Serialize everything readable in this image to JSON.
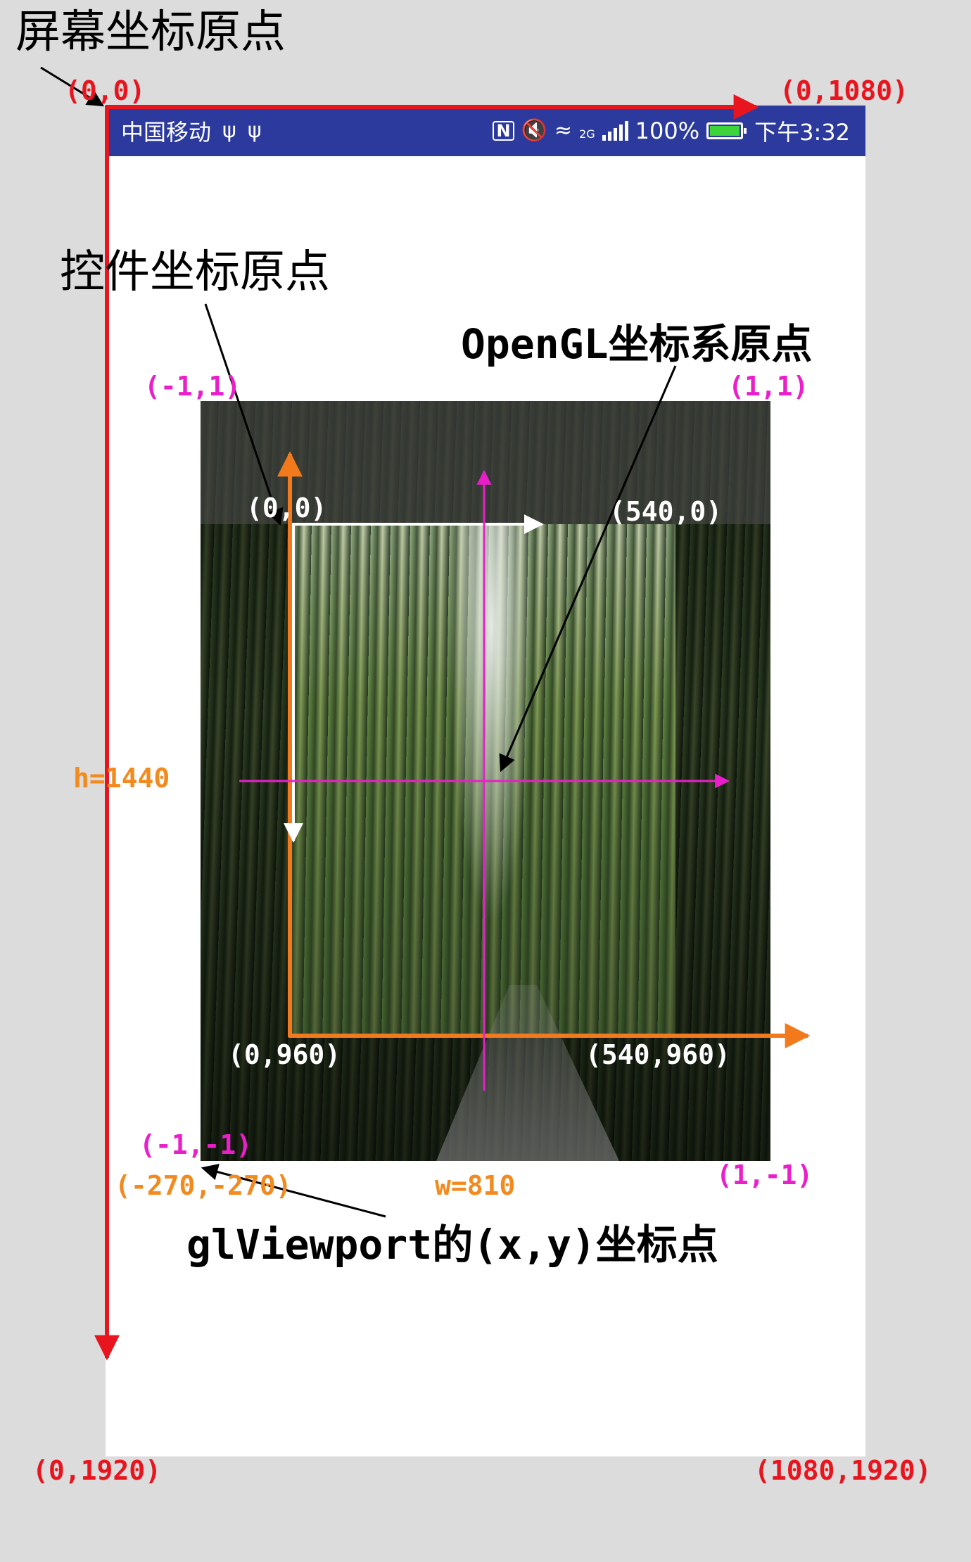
{
  "titles": {
    "screen_origin": "屏幕坐标原点",
    "widget_origin": "控件坐标原点",
    "opengl_origin": "OpenGL坐标系原点",
    "viewport_xy": "glViewport的(x,y)坐标点"
  },
  "status_bar": {
    "carrier": "中国移动",
    "usb_icon_1": "usb-icon",
    "usb_icon_2": "usb-icon",
    "nfc": "N",
    "network": "2G",
    "battery_percent": "100%",
    "time": "下午3:32"
  },
  "screen_coords": {
    "top_left": "(0,0)",
    "top_right": "(0,1080)",
    "bottom_left": "(0,1920)",
    "bottom_right": "(1080,1920)"
  },
  "widget_coords": {
    "top_left": "(0,0)",
    "top_right": "(540,0)",
    "bottom_left": "(0,960)",
    "bottom_right": "(540,960)"
  },
  "gl_coords": {
    "top_left": "(-1,1)",
    "top_right": "(1,1)",
    "bottom_left": "(-1,-1)",
    "bottom_right": "(1,-1)"
  },
  "viewport": {
    "origin": "(-270,-270)",
    "width": "w=810",
    "height": "h=1440"
  },
  "colors": {
    "screen_axes": "#e8141e",
    "widget_axes": "#f27a1c",
    "gl_axes": "#e81fc9",
    "status_bar": "#2b3a9c"
  }
}
